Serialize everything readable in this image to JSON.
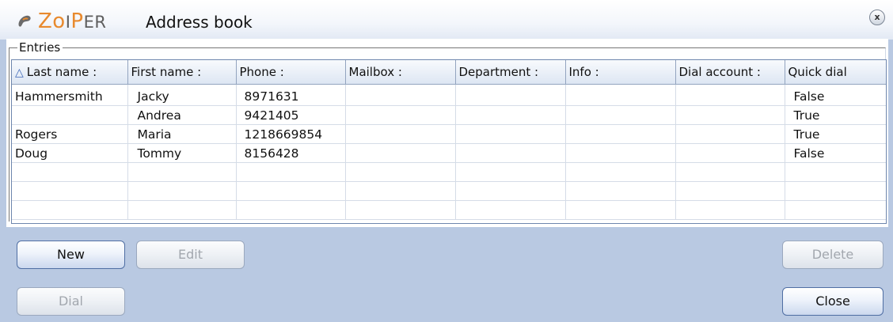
{
  "window": {
    "brand_prefix": "Zo",
    "brand_i": "I",
    "brand_p": "P",
    "brand_suffix": "ER",
    "title": "Address book",
    "close_glyph": "x"
  },
  "entries": {
    "legend": "Entries",
    "columns": [
      {
        "label": "Last name :",
        "sorted": "ascending"
      },
      {
        "label": "First name :"
      },
      {
        "label": "Phone :"
      },
      {
        "label": "Mailbox :"
      },
      {
        "label": "Department :"
      },
      {
        "label": "Info :"
      },
      {
        "label": "Dial account :"
      },
      {
        "label": "Quick dial"
      }
    ],
    "rows": [
      {
        "last": "Hammersmith",
        "first": "Jacky",
        "phone": "8971631",
        "mailbox": "",
        "department": "",
        "info": "",
        "dial_account": "",
        "quick_dial": "False"
      },
      {
        "last": "",
        "first": "Andrea",
        "phone": "9421405",
        "mailbox": "",
        "department": "",
        "info": "",
        "dial_account": "",
        "quick_dial": "True"
      },
      {
        "last": "Rogers",
        "first": "Maria",
        "phone": "1218669854",
        "mailbox": "",
        "department": "",
        "info": "",
        "dial_account": "",
        "quick_dial": "True"
      },
      {
        "last": "Doug",
        "first": "Tommy",
        "phone": "8156428",
        "mailbox": "",
        "department": "",
        "info": "",
        "dial_account": "",
        "quick_dial": "False"
      },
      {
        "last": "",
        "first": "",
        "phone": "",
        "mailbox": "",
        "department": "",
        "info": "",
        "dial_account": "",
        "quick_dial": ""
      },
      {
        "last": "",
        "first": "",
        "phone": "",
        "mailbox": "",
        "department": "",
        "info": "",
        "dial_account": "",
        "quick_dial": ""
      },
      {
        "last": "",
        "first": "",
        "phone": "",
        "mailbox": "",
        "department": "",
        "info": "",
        "dial_account": "",
        "quick_dial": ""
      }
    ]
  },
  "buttons": {
    "new": {
      "label": "New",
      "enabled": true
    },
    "edit": {
      "label": "Edit",
      "enabled": false
    },
    "delete": {
      "label": "Delete",
      "enabled": false
    },
    "dial": {
      "label": "Dial",
      "enabled": false
    },
    "close": {
      "label": "Close",
      "enabled": true
    }
  },
  "icons": {
    "logo": "zoiper-logo-icon",
    "sort": "sort-ascending-icon",
    "close": "close-icon"
  },
  "colors": {
    "brand_orange": "#e88a2e",
    "brand_gray": "#5e5e5e",
    "panel_bg": "#b9c9e2",
    "grid_border": "#6e86ad",
    "sort_icon": "#3d67b7"
  }
}
